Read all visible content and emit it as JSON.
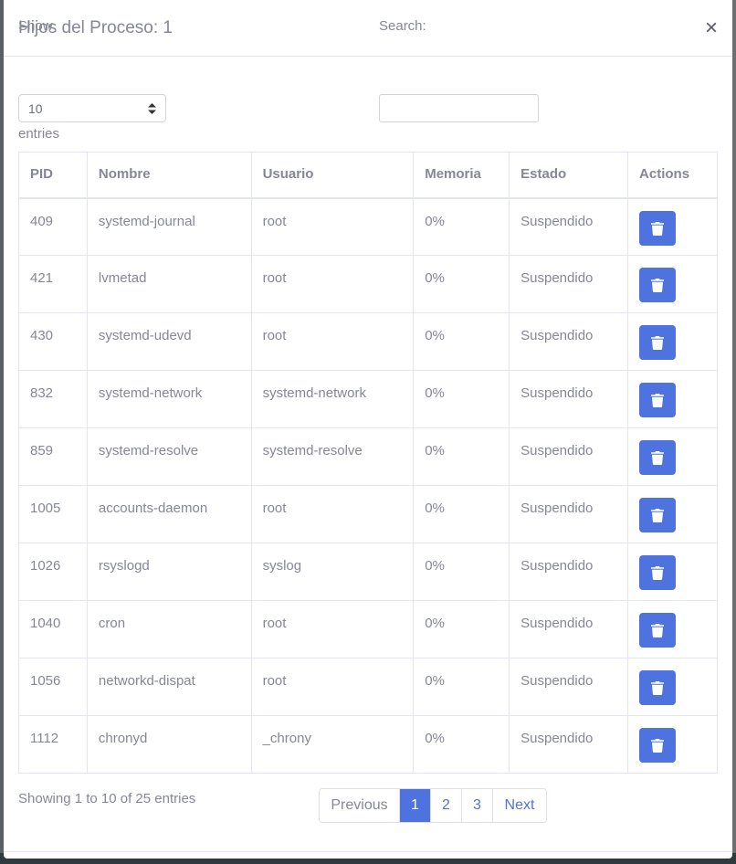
{
  "modal": {
    "title": "Hijos del Proceso: 1",
    "close_label": "×"
  },
  "controls": {
    "show_label": "Show",
    "length_value": "10",
    "entries_label": "entries",
    "search_label": "Search:",
    "search_value": ""
  },
  "table": {
    "headers": [
      "PID",
      "Nombre",
      "Usuario",
      "Memoria",
      "Estado",
      "Actions"
    ],
    "rows": [
      [
        "409",
        "systemd-journal",
        "root",
        "0%",
        "Suspendido"
      ],
      [
        "421",
        "lvmetad",
        "root",
        "0%",
        "Suspendido"
      ],
      [
        "430",
        "systemd-udevd",
        "root",
        "0%",
        "Suspendido"
      ],
      [
        "832",
        "systemd-network",
        "systemd-network",
        "0%",
        "Suspendido"
      ],
      [
        "859",
        "systemd-resolve",
        "systemd-resolve",
        "0%",
        "Suspendido"
      ],
      [
        "1005",
        "accounts-daemon",
        "root",
        "0%",
        "Suspendido"
      ],
      [
        "1026",
        "rsyslogd",
        "syslog",
        "0%",
        "Suspendido"
      ],
      [
        "1040",
        "cron",
        "root",
        "0%",
        "Suspendido"
      ],
      [
        "1056",
        "networkd-dispat",
        "root",
        "0%",
        "Suspendido"
      ],
      [
        "1112",
        "chronyd",
        "_chrony",
        "0%",
        "Suspendido"
      ]
    ],
    "row_action_icon": "trash-icon"
  },
  "footer": {
    "info": "Showing 1 to 10 of 25 entries",
    "pagination": {
      "previous": "Previous",
      "pages": [
        "1",
        "2",
        "3"
      ],
      "active_page": "1",
      "next": "Next"
    }
  },
  "colors": {
    "accent": "#4e73df",
    "text": "#858796",
    "border": "#e3e6f0"
  }
}
